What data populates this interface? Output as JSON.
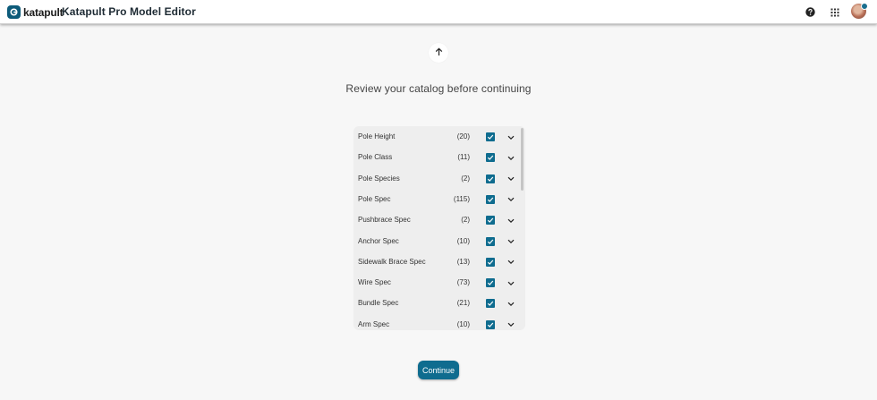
{
  "header": {
    "logo_text": "katapult",
    "app_title": "Katapult Pro Model Editor"
  },
  "icons": {
    "logo": "katapult-logo-icon",
    "help": "help-circle-icon",
    "apps": "apps-grid-icon",
    "avatar": "user-avatar",
    "up": "arrow-up-icon",
    "check": "checkbox-checked-icon",
    "chevron": "chevron-down-icon"
  },
  "colors": {
    "accent": "#0f6c8f",
    "panel_bg": "#eeeeee",
    "page_bg": "#f7f7f7"
  },
  "main": {
    "heading": "Review your catalog before continuing",
    "continue_label": "Continue"
  },
  "catalog": {
    "items": [
      {
        "label": "Pole Height",
        "count": "(20)",
        "checked": true
      },
      {
        "label": "Pole Class",
        "count": "(11)",
        "checked": true
      },
      {
        "label": "Pole Species",
        "count": "(2)",
        "checked": true
      },
      {
        "label": "Pole Spec",
        "count": "(115)",
        "checked": true
      },
      {
        "label": "Pushbrace Spec",
        "count": "(2)",
        "checked": true
      },
      {
        "label": "Anchor Spec",
        "count": "(10)",
        "checked": true
      },
      {
        "label": "Sidewalk Brace Spec",
        "count": "(13)",
        "checked": true
      },
      {
        "label": "Wire Spec",
        "count": "(73)",
        "checked": true
      },
      {
        "label": "Bundle Spec",
        "count": "(21)",
        "checked": true
      },
      {
        "label": "Arm Spec",
        "count": "(10)",
        "checked": true
      }
    ]
  }
}
